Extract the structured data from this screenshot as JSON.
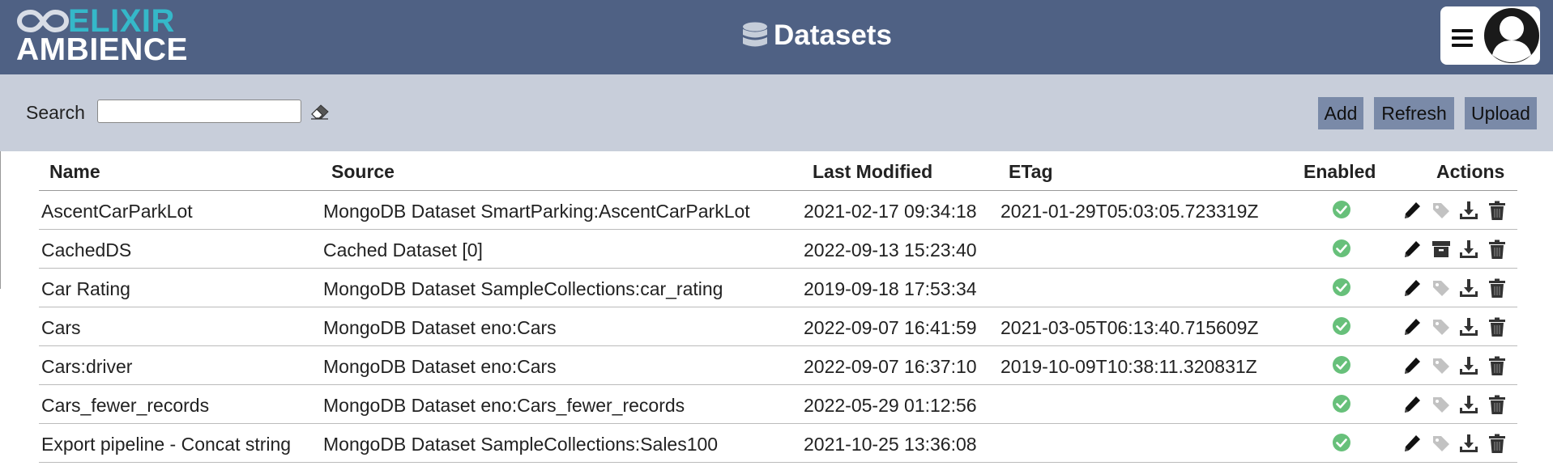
{
  "header": {
    "logo_top": "ELIXIR",
    "logo_bottom": "AMBIENCE",
    "title": "Datasets",
    "accent_color": "#35b8c9",
    "bar_color": "#4f6184"
  },
  "toolbar": {
    "search_label": "Search",
    "search_value": "",
    "add_label": "Add",
    "refresh_label": "Refresh",
    "upload_label": "Upload"
  },
  "table": {
    "columns": [
      "Name",
      "Source",
      "Last Modified",
      "ETag",
      "Enabled",
      "Actions"
    ],
    "rows": [
      {
        "name": "AscentCarParkLot",
        "source": "MongoDB Dataset SmartParking:AscentCarParkLot",
        "modified": "2021-02-17 09:34:18",
        "etag": "2021-01-29T05:03:05.723319Z",
        "enabled": true,
        "second_action": "tag-icon"
      },
      {
        "name": "CachedDS",
        "source": "Cached Dataset [0]",
        "modified": "2022-09-13 15:23:40",
        "etag": "",
        "enabled": true,
        "second_action": "archive-icon"
      },
      {
        "name": "Car Rating",
        "source": "MongoDB Dataset SampleCollections:car_rating",
        "modified": "2019-09-18 17:53:34",
        "etag": "",
        "enabled": true,
        "second_action": "tag-icon"
      },
      {
        "name": "Cars",
        "source": "MongoDB Dataset eno:Cars",
        "modified": "2022-09-07 16:41:59",
        "etag": "2021-03-05T06:13:40.715609Z",
        "enabled": true,
        "second_action": "tag-icon"
      },
      {
        "name": "Cars:driver",
        "source": "MongoDB Dataset eno:Cars",
        "modified": "2022-09-07 16:37:10",
        "etag": "2019-10-09T10:38:11.320831Z",
        "enabled": true,
        "second_action": "tag-icon"
      },
      {
        "name": "Cars_fewer_records",
        "source": "MongoDB Dataset eno:Cars_fewer_records",
        "modified": "2022-05-29 01:12:56",
        "etag": "",
        "enabled": true,
        "second_action": "tag-icon"
      },
      {
        "name": "Export pipeline - Concat string",
        "source": "MongoDB Dataset SampleCollections:Sales100",
        "modified": "2021-10-25 13:36:08",
        "etag": "",
        "enabled": true,
        "second_action": "tag-icon"
      }
    ]
  }
}
